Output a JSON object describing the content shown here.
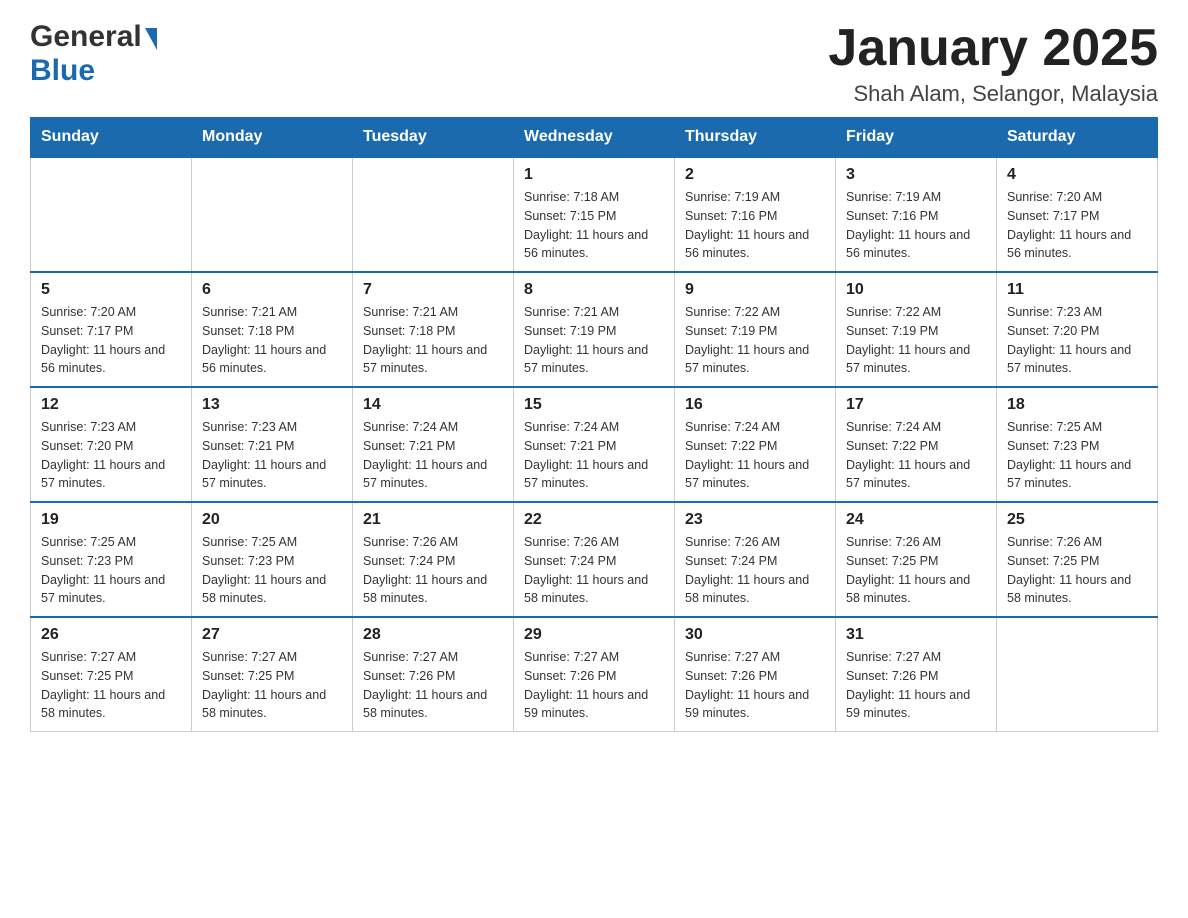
{
  "header": {
    "logo": {
      "line1": "General",
      "line2": "Blue"
    },
    "title": "January 2025",
    "subtitle": "Shah Alam, Selangor, Malaysia"
  },
  "calendar": {
    "days_of_week": [
      "Sunday",
      "Monday",
      "Tuesday",
      "Wednesday",
      "Thursday",
      "Friday",
      "Saturday"
    ],
    "weeks": [
      [
        {
          "day": "",
          "info": ""
        },
        {
          "day": "",
          "info": ""
        },
        {
          "day": "",
          "info": ""
        },
        {
          "day": "1",
          "info": "Sunrise: 7:18 AM\nSunset: 7:15 PM\nDaylight: 11 hours and 56 minutes."
        },
        {
          "day": "2",
          "info": "Sunrise: 7:19 AM\nSunset: 7:16 PM\nDaylight: 11 hours and 56 minutes."
        },
        {
          "day": "3",
          "info": "Sunrise: 7:19 AM\nSunset: 7:16 PM\nDaylight: 11 hours and 56 minutes."
        },
        {
          "day": "4",
          "info": "Sunrise: 7:20 AM\nSunset: 7:17 PM\nDaylight: 11 hours and 56 minutes."
        }
      ],
      [
        {
          "day": "5",
          "info": "Sunrise: 7:20 AM\nSunset: 7:17 PM\nDaylight: 11 hours and 56 minutes."
        },
        {
          "day": "6",
          "info": "Sunrise: 7:21 AM\nSunset: 7:18 PM\nDaylight: 11 hours and 56 minutes."
        },
        {
          "day": "7",
          "info": "Sunrise: 7:21 AM\nSunset: 7:18 PM\nDaylight: 11 hours and 57 minutes."
        },
        {
          "day": "8",
          "info": "Sunrise: 7:21 AM\nSunset: 7:19 PM\nDaylight: 11 hours and 57 minutes."
        },
        {
          "day": "9",
          "info": "Sunrise: 7:22 AM\nSunset: 7:19 PM\nDaylight: 11 hours and 57 minutes."
        },
        {
          "day": "10",
          "info": "Sunrise: 7:22 AM\nSunset: 7:19 PM\nDaylight: 11 hours and 57 minutes."
        },
        {
          "day": "11",
          "info": "Sunrise: 7:23 AM\nSunset: 7:20 PM\nDaylight: 11 hours and 57 minutes."
        }
      ],
      [
        {
          "day": "12",
          "info": "Sunrise: 7:23 AM\nSunset: 7:20 PM\nDaylight: 11 hours and 57 minutes."
        },
        {
          "day": "13",
          "info": "Sunrise: 7:23 AM\nSunset: 7:21 PM\nDaylight: 11 hours and 57 minutes."
        },
        {
          "day": "14",
          "info": "Sunrise: 7:24 AM\nSunset: 7:21 PM\nDaylight: 11 hours and 57 minutes."
        },
        {
          "day": "15",
          "info": "Sunrise: 7:24 AM\nSunset: 7:21 PM\nDaylight: 11 hours and 57 minutes."
        },
        {
          "day": "16",
          "info": "Sunrise: 7:24 AM\nSunset: 7:22 PM\nDaylight: 11 hours and 57 minutes."
        },
        {
          "day": "17",
          "info": "Sunrise: 7:24 AM\nSunset: 7:22 PM\nDaylight: 11 hours and 57 minutes."
        },
        {
          "day": "18",
          "info": "Sunrise: 7:25 AM\nSunset: 7:23 PM\nDaylight: 11 hours and 57 minutes."
        }
      ],
      [
        {
          "day": "19",
          "info": "Sunrise: 7:25 AM\nSunset: 7:23 PM\nDaylight: 11 hours and 57 minutes."
        },
        {
          "day": "20",
          "info": "Sunrise: 7:25 AM\nSunset: 7:23 PM\nDaylight: 11 hours and 58 minutes."
        },
        {
          "day": "21",
          "info": "Sunrise: 7:26 AM\nSunset: 7:24 PM\nDaylight: 11 hours and 58 minutes."
        },
        {
          "day": "22",
          "info": "Sunrise: 7:26 AM\nSunset: 7:24 PM\nDaylight: 11 hours and 58 minutes."
        },
        {
          "day": "23",
          "info": "Sunrise: 7:26 AM\nSunset: 7:24 PM\nDaylight: 11 hours and 58 minutes."
        },
        {
          "day": "24",
          "info": "Sunrise: 7:26 AM\nSunset: 7:25 PM\nDaylight: 11 hours and 58 minutes."
        },
        {
          "day": "25",
          "info": "Sunrise: 7:26 AM\nSunset: 7:25 PM\nDaylight: 11 hours and 58 minutes."
        }
      ],
      [
        {
          "day": "26",
          "info": "Sunrise: 7:27 AM\nSunset: 7:25 PM\nDaylight: 11 hours and 58 minutes."
        },
        {
          "day": "27",
          "info": "Sunrise: 7:27 AM\nSunset: 7:25 PM\nDaylight: 11 hours and 58 minutes."
        },
        {
          "day": "28",
          "info": "Sunrise: 7:27 AM\nSunset: 7:26 PM\nDaylight: 11 hours and 58 minutes."
        },
        {
          "day": "29",
          "info": "Sunrise: 7:27 AM\nSunset: 7:26 PM\nDaylight: 11 hours and 59 minutes."
        },
        {
          "day": "30",
          "info": "Sunrise: 7:27 AM\nSunset: 7:26 PM\nDaylight: 11 hours and 59 minutes."
        },
        {
          "day": "31",
          "info": "Sunrise: 7:27 AM\nSunset: 7:26 PM\nDaylight: 11 hours and 59 minutes."
        },
        {
          "day": "",
          "info": ""
        }
      ]
    ]
  }
}
